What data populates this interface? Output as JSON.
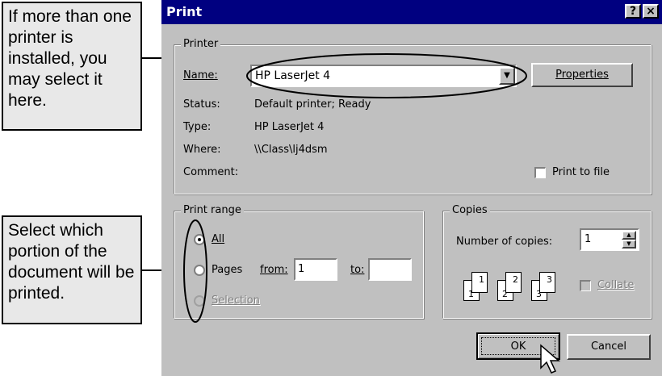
{
  "callouts": {
    "printer": "If more than one printer is installed, you may select it here.",
    "range": "Select which portion of the document will be printed."
  },
  "dialog": {
    "title": "Print",
    "help_button": "?",
    "close_button": "×"
  },
  "printer": {
    "group_label": "Printer",
    "name_label": "Name:",
    "name_value": "HP LaserJet 4",
    "properties_button": "Properties",
    "status_label": "Status:",
    "status_value": "Default printer; Ready",
    "type_label": "Type:",
    "type_value": "HP LaserJet 4",
    "where_label": "Where:",
    "where_value": "\\\\Class\\lj4dsm",
    "comment_label": "Comment:",
    "print_to_file": "Print to file"
  },
  "print_range": {
    "group_label": "Print range",
    "all": "All",
    "pages": "Pages",
    "from_label": "from:",
    "from_value": "1",
    "to_label": "to:",
    "to_value": "",
    "selection": "Selection"
  },
  "copies": {
    "group_label": "Copies",
    "number_label": "Number of copies:",
    "number_value": "1",
    "collate": "Collate",
    "page_numbers": [
      "1",
      "1",
      "2",
      "2",
      "3",
      "3"
    ]
  },
  "buttons": {
    "ok": "OK",
    "cancel": "Cancel"
  }
}
